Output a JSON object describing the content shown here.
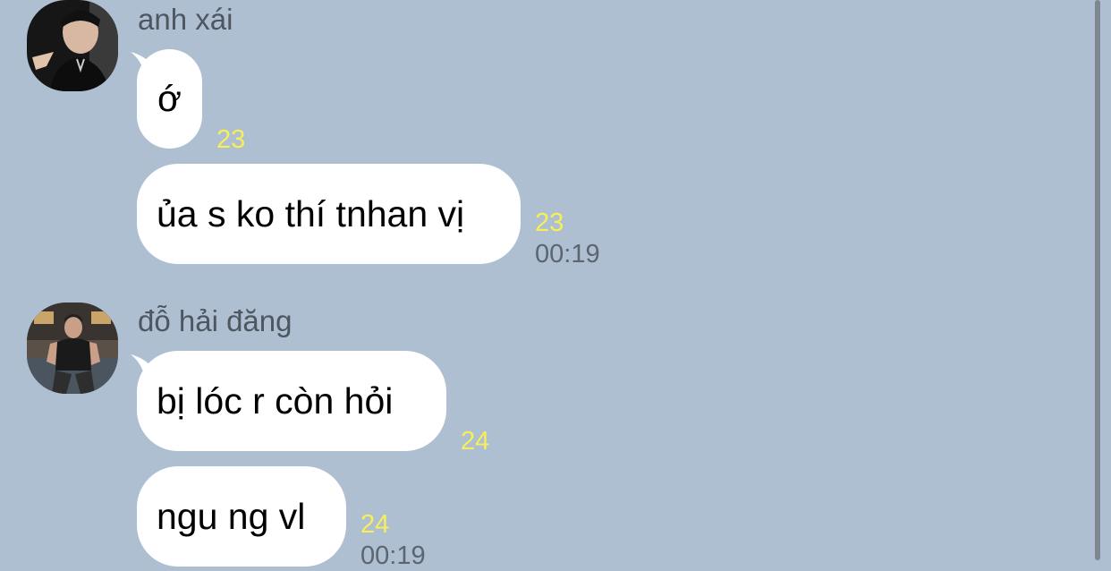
{
  "messages": [
    {
      "sender": "anh xái",
      "avatar": "avatar-anh-xai",
      "bubbles": [
        {
          "text": "ớ",
          "count": "23",
          "time": ""
        },
        {
          "text": "ủa s ko thí tnhan vị",
          "count": "23",
          "time": "00:19"
        }
      ]
    },
    {
      "sender": "đỗ hải đăng",
      "avatar": "avatar-do-hai-dang",
      "bubbles": [
        {
          "text": "bị lóc r còn hỏi",
          "count": "24",
          "time": ""
        },
        {
          "text": "ngu ng vl",
          "count": "24",
          "time": "00:19"
        }
      ]
    }
  ],
  "colors": {
    "background": "#adbfd1",
    "bubble": "#ffffff",
    "unread_count": "#f7ee5a",
    "timestamp": "#5c6570",
    "sender_name": "#4e5660"
  }
}
